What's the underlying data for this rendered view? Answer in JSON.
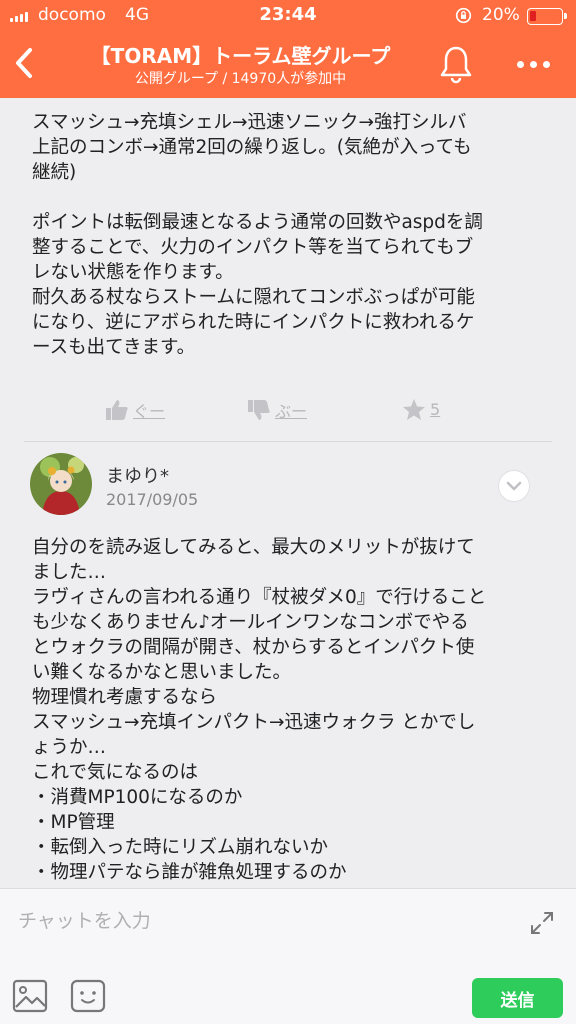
{
  "status_bar": {
    "carrier": "docomo",
    "network": "4G",
    "time": "23:44",
    "battery_percent": "20%",
    "battery_level": 0.2,
    "lock_icon": "rotation-lock-icon"
  },
  "header": {
    "back_icon": "chevron-left-icon",
    "title": "【TORAM】トーラム壁グループ",
    "subtitle": "公開グループ / 14970人が参加中",
    "bell_icon": "bell-icon",
    "more_icon": "more-icon",
    "accent_color": "#ff6e41"
  },
  "post1": {
    "text": "スマッシュ→充填シェル→迅速ソニック→強打シルバ\n上記のコンボ→通常2回の繰り返し。(気絶が入っても\n継続)\n\nポイントは転倒最速となるよう通常の回数やaspdを調\n整することで、火力のインパクト等を当てられてもブ\nレない状態を作ります。\n耐久ある杖ならストームに隠れてコンボぶっぱが可能\nになり、逆にアボられた時にインパクトに救われるケ\nースも出てきます。",
    "good_label": "ぐー",
    "boo_label": "ぶー",
    "star_count": "5"
  },
  "post2": {
    "author": "まゆり*",
    "date": "2017/09/05",
    "text": "自分のを読み返してみると、最大のメリットが抜けて\nました…\nラヴィさんの言われる通り『杖被ダメ0』で行けること\nも少なくありません♪オールインワンなコンボでやる\nとウォクラの間隔が開き、杖からするとインパクト使\nい難くなるかなと思いました。\n物理慣れ考慮するなら\nスマッシュ→充填インパクト→迅速ウォクラ とかでし\nょうか…\nこれで気になるのは\n・消費MP100になるのか\n・MP管理\n・転倒入った時にリズム崩れないか\n・物理パテなら誰が雑魚処理するのか"
  },
  "composer": {
    "placeholder": "チャットを入力",
    "send_label": "送信",
    "send_color": "#2ecc5b"
  }
}
